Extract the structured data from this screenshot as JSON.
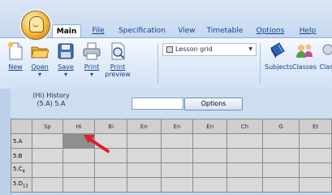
{
  "ribbon_tabs": [
    "Main",
    "File",
    "Specification",
    "View",
    "Timetable",
    "Options",
    "Help"
  ],
  "ribbon_buttons": {
    "new": "New",
    "open": "Open",
    "save": "Save",
    "print": "Print",
    "print_preview_line1": "Print",
    "print_preview_line2": "preview",
    "subjects": "Subjects",
    "classes": "Classes",
    "classes_cut": "Class"
  },
  "view_combo": {
    "value": "Lesson grid"
  },
  "form": {
    "caption_line1": "(Hi) History",
    "caption_line2": "(5.A) 5.A",
    "textbox_value": "",
    "options_button": "Options"
  },
  "grid": {
    "columns": [
      "Sp",
      "Hi",
      "Bi",
      "En",
      "En",
      "En",
      "Ch",
      "G",
      "Et"
    ],
    "rows": [
      {
        "label": "5.A",
        "suffix": ""
      },
      {
        "label": "5.B",
        "suffix": ""
      },
      {
        "label": "5.C",
        "suffix": "4"
      },
      {
        "label": "5.D",
        "suffix": "13"
      }
    ],
    "selected_cell": {
      "row": "5.A",
      "column": "Hi"
    }
  },
  "colors": {
    "ribbon_text": "#15428b",
    "annotation_arrow": "#e0202a",
    "selected_cell": "#8f8f8f"
  }
}
